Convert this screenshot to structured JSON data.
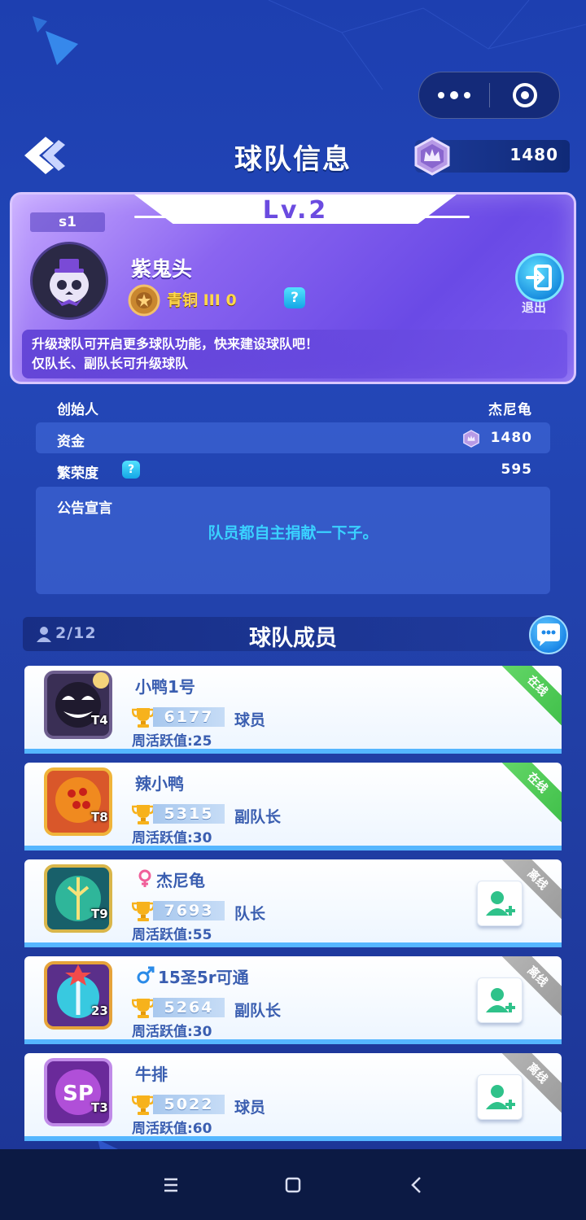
{
  "header": {
    "title": "球队信息",
    "coins": "1480"
  },
  "team": {
    "level": "Lv.2",
    "season": "s1",
    "name": "紫鬼头",
    "rank": "青铜 III 0",
    "exit_label": "退出",
    "notice_lines": [
      "升级球队可开启更多球队功能，快来建设球队吧！",
      "仅队长、副队长可升级球队"
    ]
  },
  "info": {
    "founder_label": "创始人",
    "founder_value": "杰尼龟",
    "funds_label": "资金",
    "funds_value": "1480",
    "prosperity_label": "繁荣度",
    "prosperity_value": "595",
    "announcement_label": "公告宣言",
    "announcement_text": "队员都自主捐献一下子。"
  },
  "members_section": {
    "count": "2/12",
    "title": "球队成员"
  },
  "members": [
    {
      "name": "小鸭1号",
      "level": "T4",
      "score": "6177",
      "role": "球员",
      "activity": "周活跃值:25",
      "status": "在线",
      "online": true,
      "gender": ""
    },
    {
      "name": "辣小鸭",
      "level": "T8",
      "score": "5315",
      "role": "副队长",
      "activity": "周活跃值:30",
      "status": "在线",
      "online": true,
      "gender": ""
    },
    {
      "name": "杰尼龟",
      "level": "T9",
      "score": "7693",
      "role": "队长",
      "activity": "周活跃值:55",
      "status": "离线",
      "online": false,
      "gender": "female"
    },
    {
      "name": "15圣5r可通",
      "level": "23",
      "score": "5264",
      "role": "副队长",
      "activity": "周活跃值:30",
      "status": "离线",
      "online": false,
      "gender": "male"
    },
    {
      "name": "牛排",
      "level": "T3",
      "score": "5022",
      "role": "球员",
      "activity": "周活跃值:60",
      "status": "离线",
      "online": false,
      "gender": ""
    }
  ],
  "colors": {
    "accent": "#3ad1ff",
    "member_text": "#3a5eb0",
    "online": "#4cc651",
    "offline": "#a6a6a6"
  }
}
